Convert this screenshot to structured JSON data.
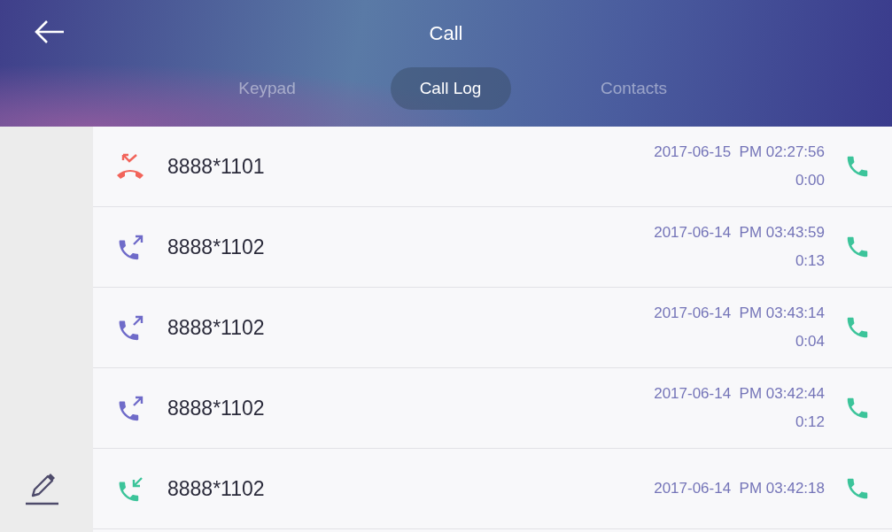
{
  "header": {
    "title": "Call"
  },
  "tabs": [
    {
      "label": "Keypad",
      "selected": false
    },
    {
      "label": "Call Log",
      "selected": true
    },
    {
      "label": "Contacts",
      "selected": false
    }
  ],
  "calls": [
    {
      "kind": "missed",
      "number": "8888*1101",
      "time": "2017-06-15  PM 02:27:56",
      "duration": "0:00"
    },
    {
      "kind": "outgoing",
      "number": "8888*1102",
      "time": "2017-06-14  PM 03:43:59",
      "duration": "0:13"
    },
    {
      "kind": "outgoing",
      "number": "8888*1102",
      "time": "2017-06-14  PM 03:43:14",
      "duration": "0:04"
    },
    {
      "kind": "outgoing",
      "number": "8888*1102",
      "time": "2017-06-14  PM 03:42:44",
      "duration": "0:12"
    },
    {
      "kind": "incoming",
      "number": "8888*1102",
      "time": "2017-06-14  PM 03:42:18"
    }
  ]
}
